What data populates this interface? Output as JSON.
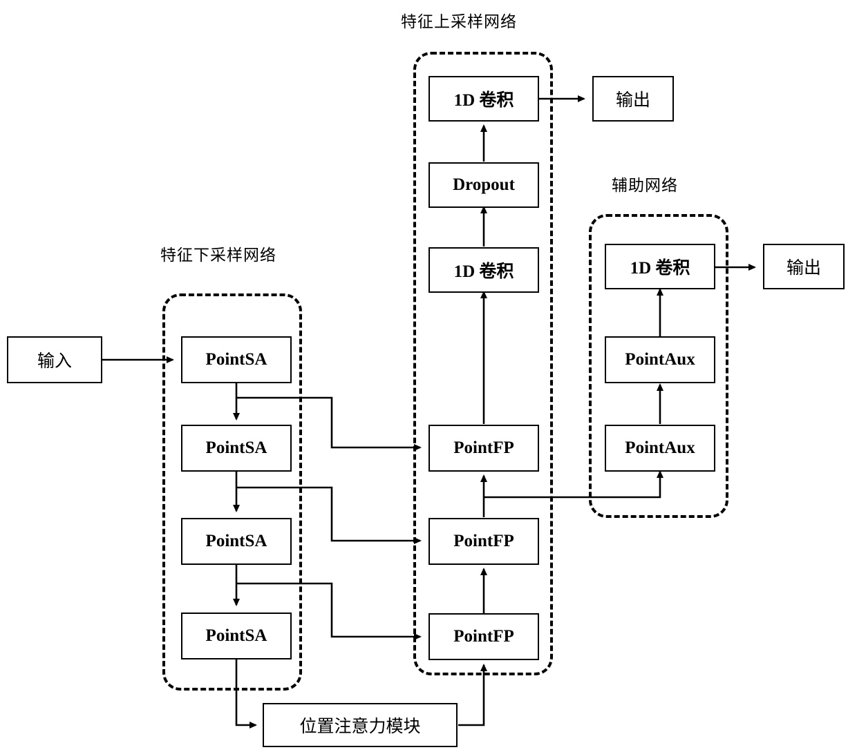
{
  "diagram": {
    "title_hidden": "",
    "groups": [
      {
        "id": "upsample",
        "label": "特征上采样网络"
      },
      {
        "id": "downsample",
        "label": "特征下采样网络"
      },
      {
        "id": "auxiliary",
        "label": "辅助网络"
      }
    ],
    "nodes": {
      "input": "输入",
      "sa1": "PointSA",
      "sa2": "PointSA",
      "sa3": "PointSA",
      "sa4": "PointSA",
      "pos_attention": "位置注意力模块",
      "fp1": "PointFP",
      "fp2": "PointFP",
      "fp3": "PointFP",
      "fp4": "PointFP",
      "conv1d_mid": "1D 卷积",
      "dropout": "Dropout",
      "conv1d_top": "1D 卷积",
      "output_main": "输出",
      "aux1": "PointAux",
      "aux2": "PointAux",
      "conv1d_aux": "1D 卷积",
      "output_aux": "输出"
    },
    "colors": {
      "stroke": "#000000",
      "background": "#ffffff"
    }
  }
}
